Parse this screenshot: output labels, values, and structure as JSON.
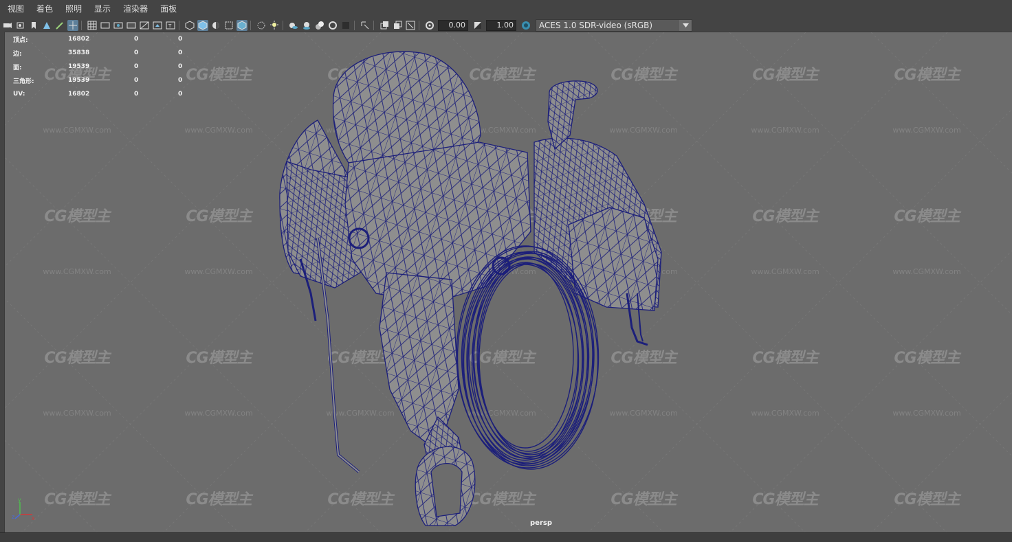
{
  "menu": [
    "视图",
    "着色",
    "照明",
    "显示",
    "渲染器",
    "面板"
  ],
  "toolbar": {
    "exposure_value": "0.00",
    "gamma_value": "1.00",
    "color_space": "ACES 1.0 SDR-video (sRGB)",
    "icons": [
      "select-camera-icon",
      "camera-attr-icon",
      "bookmark-icon",
      "image-plane-icon",
      "grease-pencil-icon",
      "2d-pan-zoom-icon",
      "grid-icon",
      "film-gate-icon",
      "resolution-gate-icon",
      "gate-mask-icon",
      "field-chart-icon",
      "safe-action-icon",
      "safe-title-icon",
      "wireframe-icon",
      "smooth-shade-icon",
      "default-material-icon",
      "textured-icon",
      "wireframe-on-shaded-icon",
      "xray-icon",
      "use-lights-icon",
      "shadows-icon",
      "screen-space-ao-icon",
      "motion-blur-icon",
      "multisample-aa-icon",
      "depth-of-field-icon",
      "isolate-select-icon",
      "xray-joints-icon",
      "xray-active-icon",
      "backface-icon",
      "exposure-icon",
      "gamma-icon",
      "color-management-icon"
    ]
  },
  "hud": {
    "rows": [
      {
        "label": "顶点:",
        "v1": "16802",
        "v2": "0",
        "v3": "0"
      },
      {
        "label": "边:",
        "v1": "35838",
        "v2": "0",
        "v3": "0"
      },
      {
        "label": "面:",
        "v1": "19539",
        "v2": "0",
        "v3": "0"
      },
      {
        "label": "三角形:",
        "v1": "19539",
        "v2": "0",
        "v3": "0"
      },
      {
        "label": "UV:",
        "v1": "16802",
        "v2": "0",
        "v3": "0"
      }
    ]
  },
  "watermark": {
    "logo": "CG模型主",
    "url": "www.CGMXW.com"
  },
  "viewport": {
    "camera": "persp",
    "background": "#6c6c6c",
    "wire_color": "#1c1f7a",
    "mesh_color": "#8e8e8e"
  },
  "axis": {
    "x": "x",
    "y": "y",
    "z": "z"
  }
}
